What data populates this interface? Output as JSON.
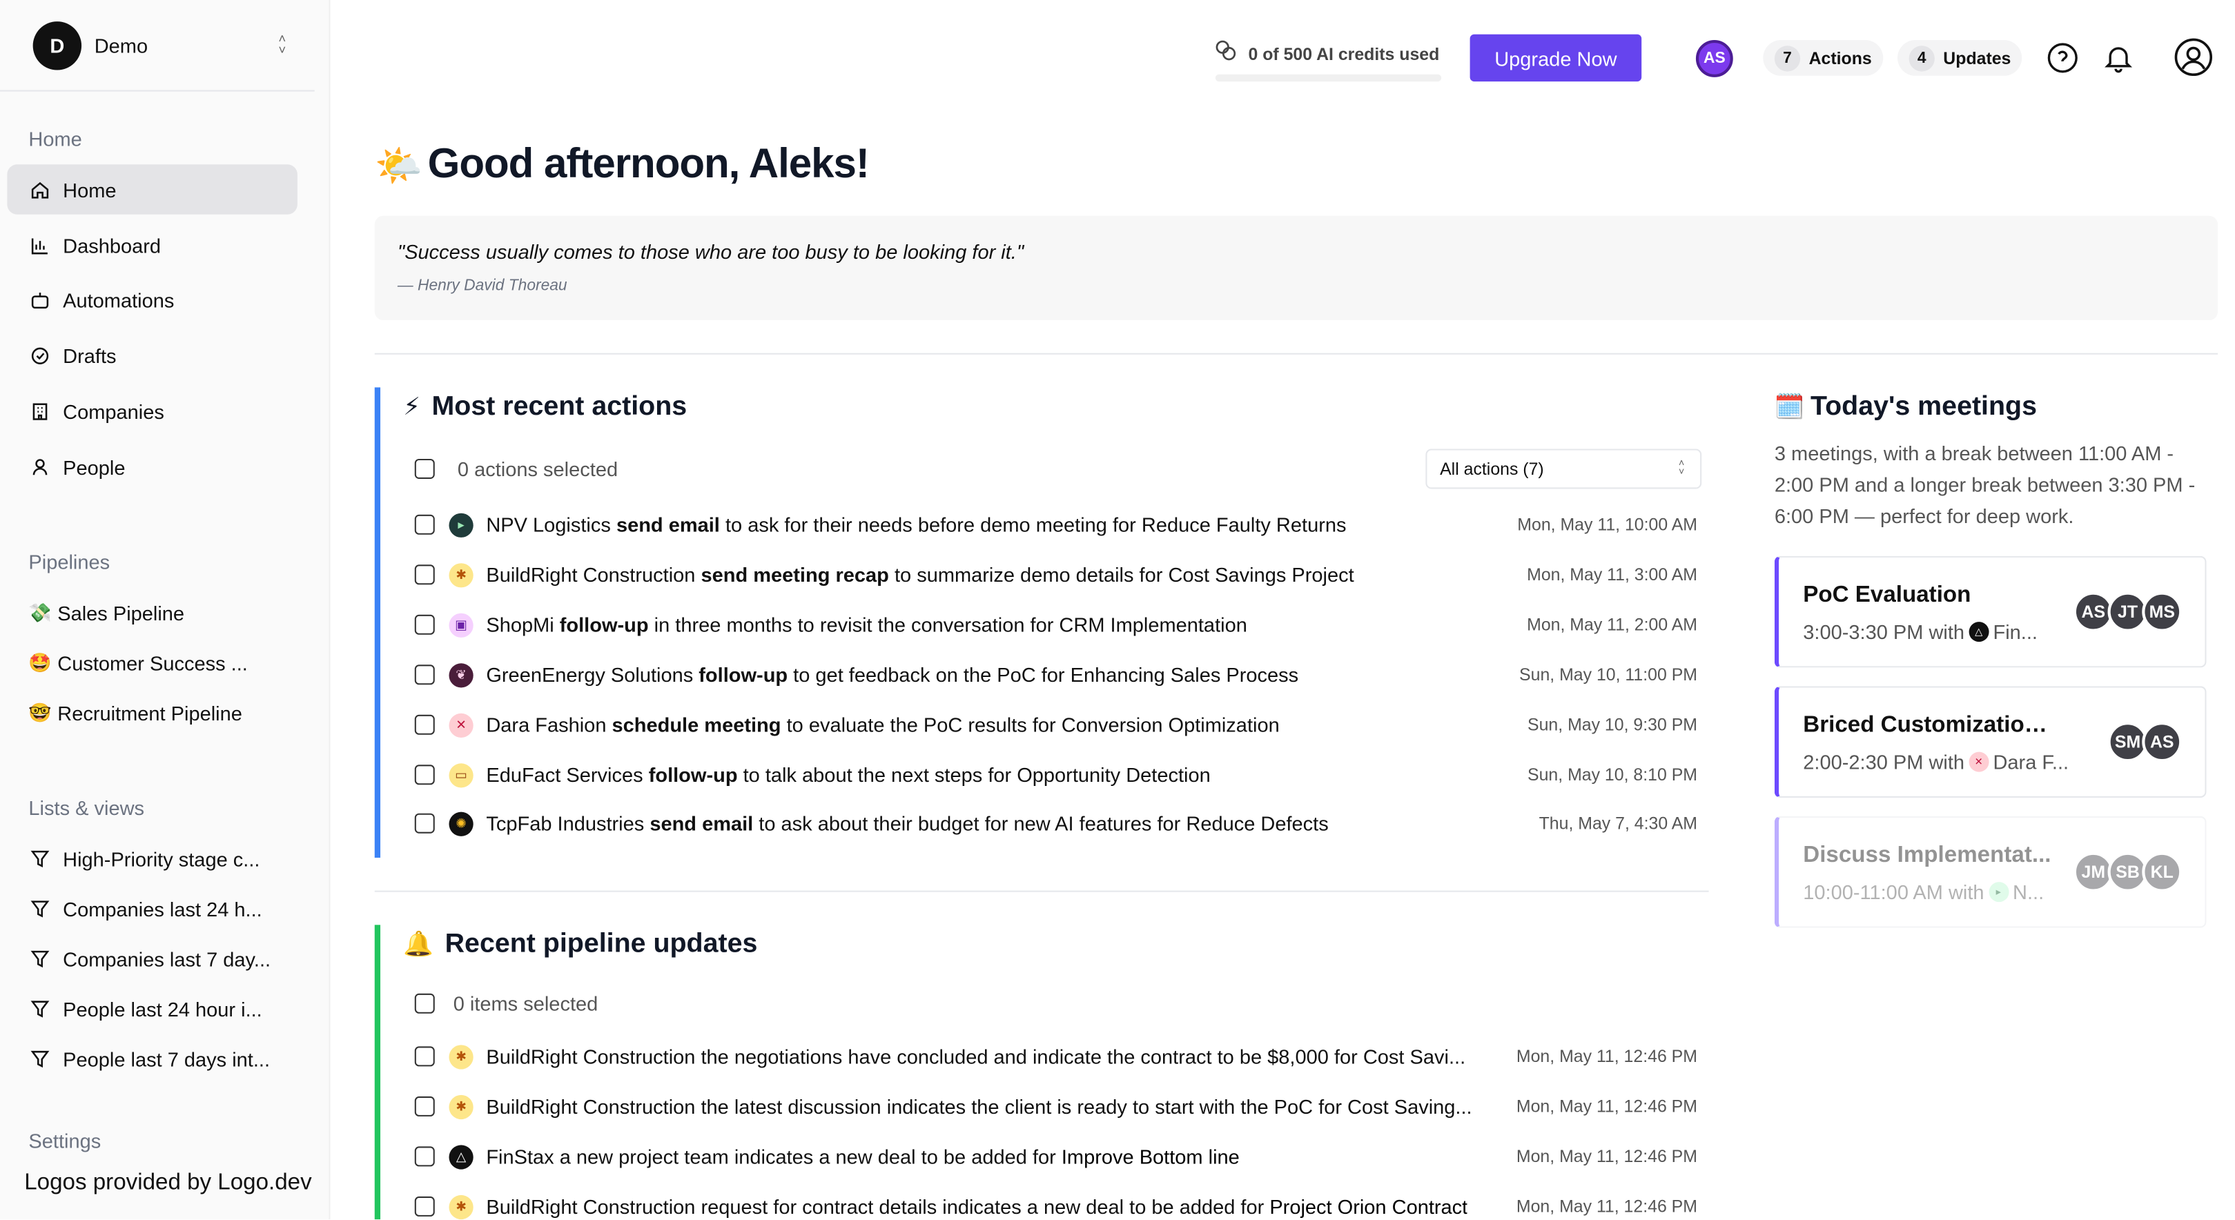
{
  "workspace": {
    "initial": "D",
    "name": "Demo"
  },
  "sidebar": {
    "home_title": "Home",
    "home_items": [
      {
        "label": "Home",
        "icon": "home-icon"
      },
      {
        "label": "Dashboard",
        "icon": "chart-icon"
      },
      {
        "label": "Automations",
        "icon": "robot-icon"
      },
      {
        "label": "Drafts",
        "icon": "check-circle-icon"
      },
      {
        "label": "Companies",
        "icon": "building-icon"
      },
      {
        "label": "People",
        "icon": "person-icon"
      }
    ],
    "pipelines_title": "Pipelines",
    "pipelines": [
      {
        "label": "Sales Pipeline",
        "emoji": "💸"
      },
      {
        "label": "Customer Success ...",
        "emoji": "🤩"
      },
      {
        "label": "Recruitment Pipeline",
        "emoji": "🤓"
      }
    ],
    "lists_title": "Lists & views",
    "lists": [
      {
        "label": "High-Priority stage c..."
      },
      {
        "label": "Companies last 24 h..."
      },
      {
        "label": "Companies last 7 day..."
      },
      {
        "label": "People last 24 hour i..."
      },
      {
        "label": "People last 7 days int..."
      }
    ],
    "settings_title": "Settings",
    "footer": "Logos provided by Logo.dev"
  },
  "topbar": {
    "credits_text": "0 of 500 AI credits used",
    "credits_used_fraction": 0,
    "upgrade_label": "Upgrade Now",
    "user_initials": "AS",
    "actions_count": "7",
    "actions_label": "Actions",
    "updates_count": "4",
    "updates_label": "Updates"
  },
  "greeting": {
    "emoji": "🌤️",
    "text": "Good afternoon, Aleks!"
  },
  "quote": {
    "text": "\"Success usually comes to those who are too busy to be looking for it.\"",
    "author": "— Henry David Thoreau"
  },
  "actions": {
    "emoji": "⚡",
    "title": "Most recent actions",
    "selected_text": "0 actions selected",
    "filter_label": "All actions (7)",
    "rows": [
      {
        "company": "NPV Logistics",
        "verb": "send email",
        "rest": "to ask for their needs before demo meeting for Reduce Faulty Returns",
        "date": "Mon, May 11, 10:00 AM"
      },
      {
        "company": "BuildRight Construction",
        "verb": "send meeting recap",
        "rest": "to summarize demo details for Cost Savings Project",
        "date": "Mon, May 11, 3:00 AM"
      },
      {
        "company": "ShopMi",
        "verb": "follow-up",
        "rest": "in three months to revisit the conversation for CRM Implementation",
        "date": "Mon, May 11, 2:00 AM"
      },
      {
        "company": "GreenEnergy Solutions",
        "verb": "follow-up",
        "rest": "to get feedback on the PoC for Enhancing Sales Process",
        "date": "Sun, May 10, 11:00 PM"
      },
      {
        "company": "Dara Fashion",
        "verb": "schedule meeting",
        "rest": "to evaluate the PoC results for Conversion Optimization",
        "date": "Sun, May 10, 9:30 PM"
      },
      {
        "company": "EduFact Services",
        "verb": "follow-up",
        "rest": "to talk about the next steps for Opportunity Detection",
        "date": "Sun, May 10, 8:10 PM"
      },
      {
        "company": "TcpFab Industries",
        "verb": "send email",
        "rest": "to ask about their budget for new AI features for Reduce Defects",
        "date": "Thu, May 7, 4:30 AM"
      }
    ]
  },
  "updates": {
    "emoji": "🔔",
    "title": "Recent pipeline updates",
    "selected_text": "0 items selected",
    "rows": [
      {
        "text": "BuildRight Construction the negotiations have concluded and indicate the contract to be $8,000 for Cost Savi...",
        "bold": "",
        "date": "Mon, May 11, 12:46 PM"
      },
      {
        "text": "BuildRight Construction the latest discussion indicates the client is ready to start with the PoC for Cost Saving...",
        "bold": "",
        "date": "Mon, May 11, 12:46 PM"
      },
      {
        "text": "FinStax a new project team indicates a new deal to be added for ",
        "bold": "Improve Bottom line",
        "date": "Mon, May 11, 12:46 PM"
      },
      {
        "text": "BuildRight Construction request for contract details indicates a new deal to be added for ",
        "bold": "Project Orion Contract",
        "date": "Mon, May 11, 12:46 PM"
      }
    ]
  },
  "meetings": {
    "emoji": "🗓️",
    "title": "Today's meetings",
    "description": "3 meetings, with a break between 11:00 AM - 2:00 PM and a longer break between 3:30 PM - 6:00 PM — perfect for deep work.",
    "cards": [
      {
        "title": "PoC Evaluation",
        "time": "3:00-3:30 PM with",
        "company": "Fin...",
        "attendees": [
          "AS",
          "JT",
          "MS"
        ]
      },
      {
        "title": "Briced Customization O...",
        "time": "2:00-2:30 PM with",
        "company": "Dara F...",
        "attendees": [
          "SM",
          "AS"
        ]
      },
      {
        "title": "Discuss Implementat...",
        "time": "10:00-11:00 AM with",
        "company": "N...",
        "attendees": [
          "JM",
          "SB",
          "KL"
        ]
      }
    ]
  },
  "colors": {
    "accent": "#6644ee",
    "actions_bar": "#3b82f6",
    "updates_bar": "#22c55e"
  }
}
